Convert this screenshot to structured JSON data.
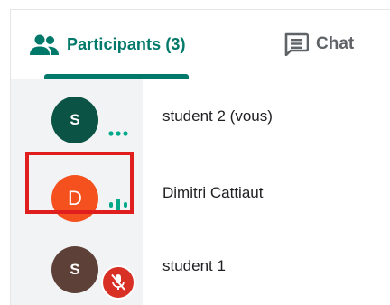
{
  "tabs": {
    "participants_label": "Participants (3)",
    "chat_label": "Chat"
  },
  "participants": [
    {
      "initial": "S",
      "name": "student 2 (vous)",
      "avatar_color": "#0b5345",
      "audio_indicator": "dots"
    },
    {
      "initial": "D",
      "name": "Dimitri Cattiaut",
      "avatar_color": "#f4511e",
      "audio_indicator": "speaking-bars"
    },
    {
      "initial": "S",
      "name": "student 1",
      "avatar_color": "#5d4037",
      "audio_indicator": "mic-muted"
    }
  ],
  "colors": {
    "accent": "#00796b",
    "indicator": "#00a889",
    "highlight": "#e01e1e",
    "muted_badge": "#d93025"
  },
  "icons": {
    "participants_tab": "people-icon",
    "chat_tab": "chat-bubble-icon"
  }
}
